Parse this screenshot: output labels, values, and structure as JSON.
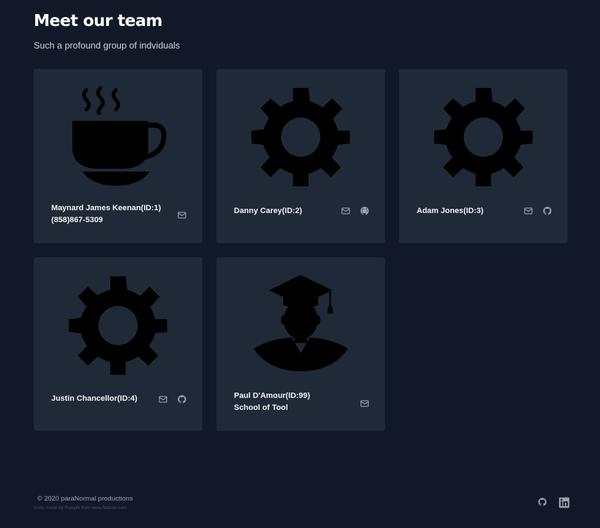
{
  "header": {
    "title": "Meet our team",
    "subtitle": "Such a profound group of indviduals"
  },
  "members": [
    {
      "name": "Maynard James Keenan(ID:1)",
      "sub": "(858)867-5309",
      "icon": "coffee-cup-icon",
      "links": [
        "mail-icon"
      ]
    },
    {
      "name": "Danny Carey(ID:2)",
      "sub": "",
      "icon": "gear-icon",
      "links": [
        "mail-icon",
        "github-icon"
      ]
    },
    {
      "name": "Adam Jones(ID:3)",
      "sub": "",
      "icon": "gear-icon",
      "links": [
        "mail-icon",
        "github-icon"
      ]
    },
    {
      "name": "Justin Chancellor(ID:4)",
      "sub": "",
      "icon": "gear-icon",
      "links": [
        "mail-icon",
        "github-icon"
      ]
    },
    {
      "name": "Paul D'Amour(ID:99)",
      "sub": "School of Tool",
      "icon": "graduate-icon",
      "links": [
        "mail-icon"
      ]
    }
  ],
  "footer": {
    "copyright": "© 2020 paraNormal productions",
    "credits": "Icons made by Freepik from www.flaticon.com",
    "links": [
      "github-icon",
      "linkedin-icon"
    ]
  },
  "colors": {
    "background": "#111827",
    "card": "#1f2937",
    "icon_muted": "#9ca3af",
    "art": "#000000"
  }
}
